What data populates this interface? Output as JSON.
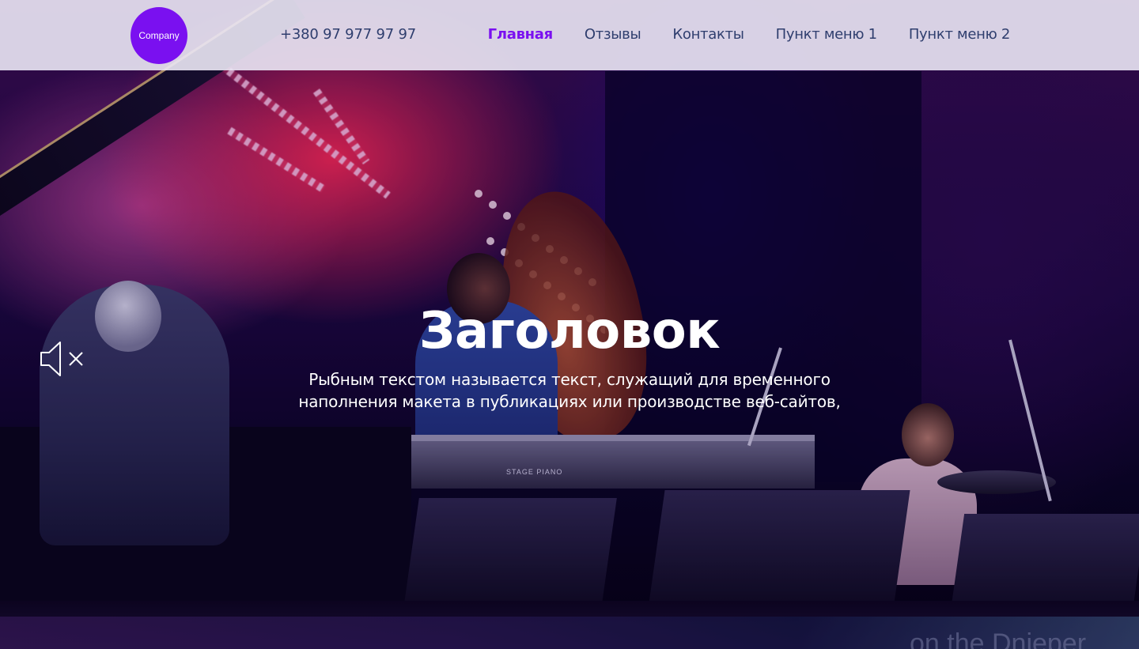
{
  "header": {
    "logo_text": "Company",
    "phone": "+380 97 977 97 97",
    "nav": [
      {
        "label": "Главная",
        "active": true
      },
      {
        "label": "Отзывы",
        "active": false
      },
      {
        "label": "Контакты",
        "active": false
      },
      {
        "label": "Пункт меню 1",
        "active": false
      },
      {
        "label": "Пункт меню 2",
        "active": false
      }
    ]
  },
  "hero": {
    "title": "Заголовок",
    "text": "Рыбным текстом называется текст, служащий для временного наполнения макета в публикациях или производстве веб-сайтов,",
    "background_image": {
      "keyboard_label": "STAGE PIANO",
      "banner_text": "on the Dnieper"
    },
    "sound": {
      "icon": "speaker-muted-icon",
      "muted": true
    }
  },
  "colors": {
    "accent": "#7a10f0",
    "nav_text": "#2f3e6e",
    "header_bg": "#ebe8f5",
    "hero_text": "#ffffff"
  }
}
